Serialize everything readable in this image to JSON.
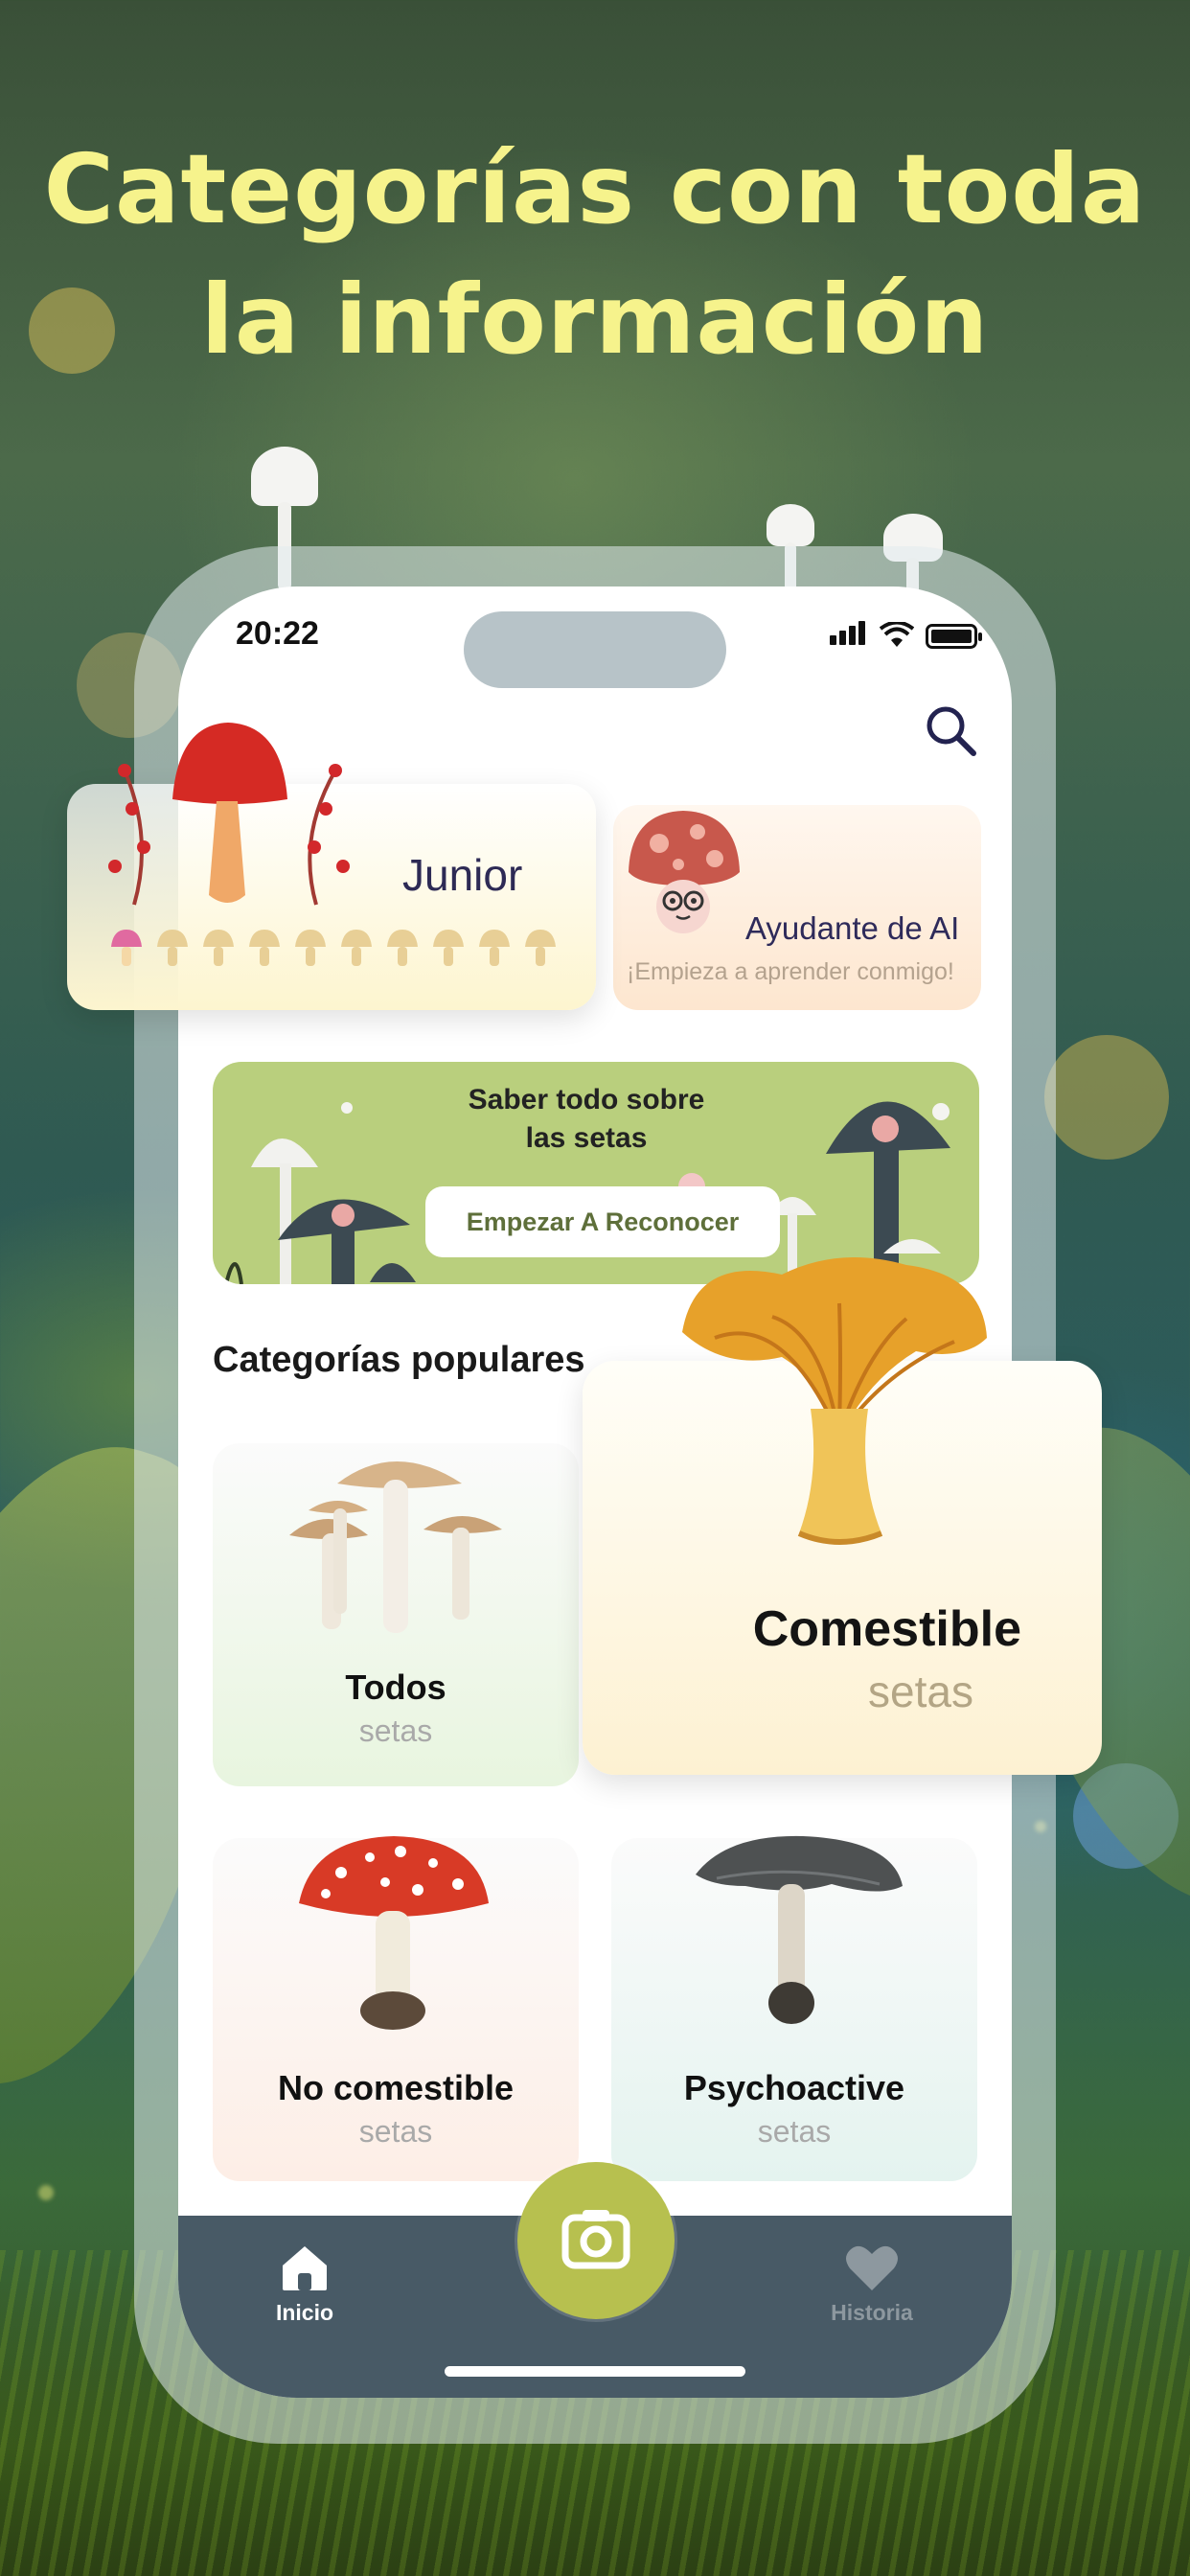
{
  "headline": {
    "line1": "Categorías con toda",
    "line2": "la información"
  },
  "status_bar": {
    "time": "20:22",
    "icons": [
      "signal-icon",
      "wifi-icon",
      "battery-icon"
    ]
  },
  "header": {
    "search_icon": "search-icon"
  },
  "level_card": {
    "label": "Junior",
    "icon": "red-mushroom-icon",
    "progress_icons": [
      "pink-mushroom-icon",
      "mushroom-icon",
      "mushroom-icon",
      "mushroom-icon",
      "mushroom-icon",
      "mushroom-icon",
      "mushroom-icon",
      "mushroom-icon",
      "mushroom-icon",
      "mushroom-icon"
    ],
    "progress_filled": 1,
    "progress_total": 10
  },
  "ai_card": {
    "title": "Ayudante de AI",
    "subtitle": "¡Empieza a aprender conmigo!",
    "icon": "mushroom-mascot-icon"
  },
  "banner": {
    "title_line1": "Saber todo sobre",
    "title_line2": "las setas",
    "button": "Empezar A Reconocer"
  },
  "categories": {
    "title": "Categorías populares",
    "items": [
      {
        "name": "Todos",
        "sub": "setas",
        "icon": "white-mushroom-cluster-icon"
      },
      {
        "name": "Comestible",
        "sub": "setas",
        "icon": "chanterelle-icon"
      },
      {
        "name": "No comestible",
        "sub": "setas",
        "icon": "fly-agaric-icon"
      },
      {
        "name": "Psychoactive",
        "sub": "setas",
        "icon": "dark-mushroom-icon"
      }
    ]
  },
  "tabbar": {
    "home_label": "Inicio",
    "history_label": "Historia",
    "camera_icon": "camera-icon"
  },
  "colors": {
    "headline": "#f6f38c",
    "tabbar": "#485a66",
    "camera_button": "#b7c04f",
    "banner": "#b9cf7d"
  }
}
